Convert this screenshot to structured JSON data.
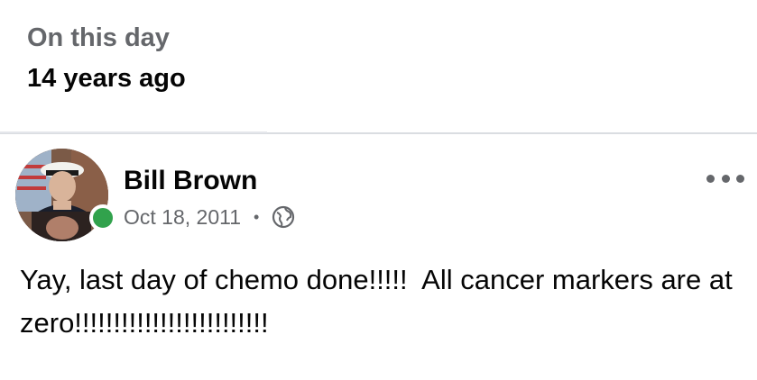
{
  "memory": {
    "label": "On this day",
    "years_ago": "14 years ago"
  },
  "post": {
    "author": "Bill Brown",
    "date": "Oct 18, 2011",
    "separator": "•",
    "privacy_icon": "globe-icon",
    "more_icon": "more-options-icon",
    "avatar_icon": "profile-photo",
    "online_status": "online",
    "text": "Yay, last day of chemo done!!!!!  All cancer markers are at zero!!!!!!!!!!!!!!!!!!!!!!!!!"
  },
  "colors": {
    "primary_text": "#050505",
    "secondary_text": "#65676b",
    "online_green": "#31a24c",
    "divider": "#dadde1"
  }
}
